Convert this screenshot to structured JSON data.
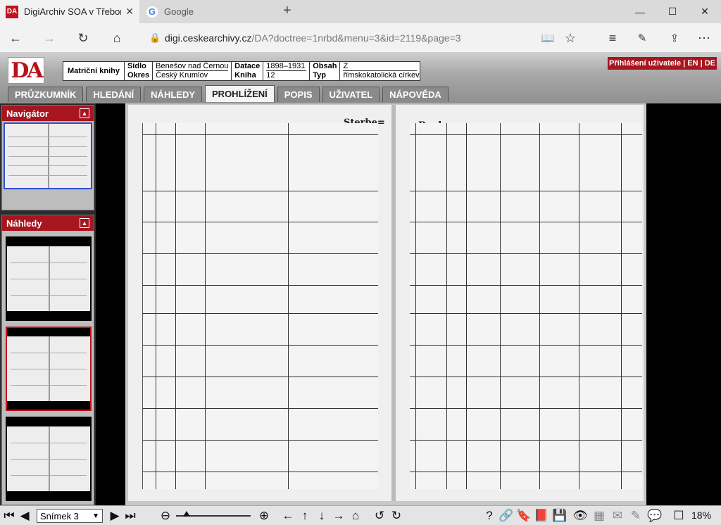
{
  "browser": {
    "tabs": [
      {
        "title": "DigiArchiv SOA v Třeboni",
        "favicon": "DA"
      },
      {
        "title": "Google",
        "favicon": "G"
      }
    ],
    "url": {
      "host": "digi.ceskearchivy.cz",
      "path": "/DA?doctree=1nrbd&menu=3&id=2119&page=3"
    }
  },
  "app": {
    "logo": "DA",
    "record_type": "Matriční knihy",
    "fields": {
      "sidlo_label": "Sídlo",
      "sidlo": "Benešov nad Černou",
      "okres_label": "Okres",
      "okres": "Český Krumlov",
      "datace_label": "Datace",
      "datace": "1898–1931",
      "kniha_label": "Kniha",
      "kniha": "12",
      "obsah_label": "Obsah",
      "obsah": "Z",
      "typ_label": "Typ",
      "typ": "římskokatolická církev"
    },
    "login": "Přihlášení uživatele | EN | DE",
    "menu": [
      "PRŮZKUMNÍK",
      "HLEDÁNÍ",
      "NÁHLEDY",
      "PROHLÍŽENÍ",
      "POPIS",
      "UŽIVATEL",
      "NÁPOVĚDA"
    ],
    "active_menu": "PROHLÍŽENÍ"
  },
  "sidebar": {
    "navigator_title": "Navigátor",
    "previews_title": "Náhledy"
  },
  "viewer": {
    "left_heading": "Sterbe=",
    "right_heading": "Buch."
  },
  "toolbar": {
    "snapshot": "Snímek 3",
    "zoom": "18%"
  },
  "colors": {
    "accent": "#a7151f",
    "selection": "#2f4fd0"
  }
}
